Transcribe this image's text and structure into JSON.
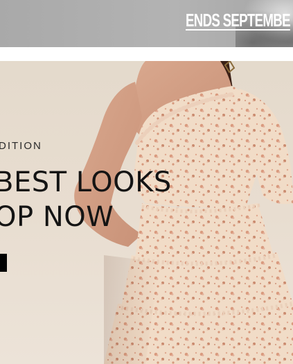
{
  "promo": {
    "text": "ENDS SEPTEMBE"
  },
  "hero": {
    "eyebrow": "DITION",
    "headline_line1": "BEST LOOKS",
    "headline_line2": "OP NOW"
  },
  "colors": {
    "promo_background": "#b0b0b0",
    "hero_background": "#e6dccf",
    "headline_text": "#141414",
    "cta": "#000000"
  }
}
